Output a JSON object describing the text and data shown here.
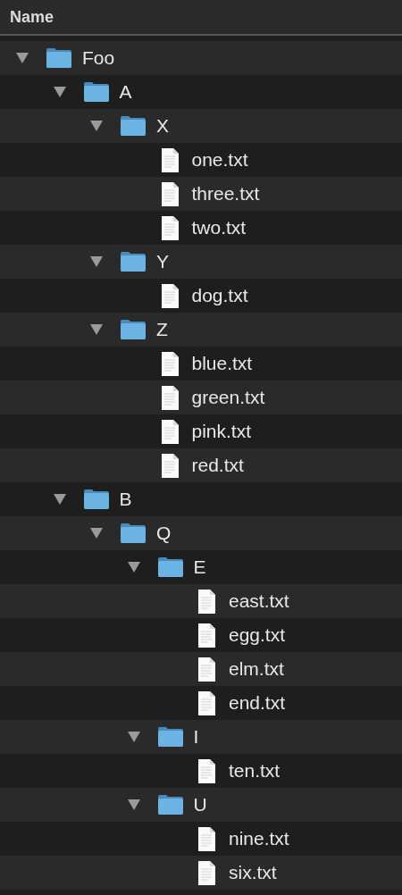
{
  "header": {
    "column_1": "Name"
  },
  "tree": [
    {
      "name": "Foo",
      "kind": "folder",
      "expanded": true,
      "children": [
        {
          "name": "A",
          "kind": "folder",
          "expanded": true,
          "children": [
            {
              "name": "X",
              "kind": "folder",
              "expanded": true,
              "children": [
                {
                  "name": "one.txt",
                  "kind": "file"
                },
                {
                  "name": "three.txt",
                  "kind": "file"
                },
                {
                  "name": "two.txt",
                  "kind": "file"
                }
              ]
            },
            {
              "name": "Y",
              "kind": "folder",
              "expanded": true,
              "children": [
                {
                  "name": "dog.txt",
                  "kind": "file"
                }
              ]
            },
            {
              "name": "Z",
              "kind": "folder",
              "expanded": true,
              "children": [
                {
                  "name": "blue.txt",
                  "kind": "file"
                },
                {
                  "name": "green.txt",
                  "kind": "file"
                },
                {
                  "name": "pink.txt",
                  "kind": "file"
                },
                {
                  "name": "red.txt",
                  "kind": "file"
                }
              ]
            }
          ]
        },
        {
          "name": "B",
          "kind": "folder",
          "expanded": true,
          "children": [
            {
              "name": "Q",
              "kind": "folder",
              "expanded": true,
              "children": [
                {
                  "name": "E",
                  "kind": "folder",
                  "expanded": true,
                  "children": [
                    {
                      "name": "east.txt",
                      "kind": "file"
                    },
                    {
                      "name": "egg.txt",
                      "kind": "file"
                    },
                    {
                      "name": "elm.txt",
                      "kind": "file"
                    },
                    {
                      "name": "end.txt",
                      "kind": "file"
                    }
                  ]
                },
                {
                  "name": "I",
                  "kind": "folder",
                  "expanded": true,
                  "children": [
                    {
                      "name": "ten.txt",
                      "kind": "file"
                    }
                  ]
                },
                {
                  "name": "U",
                  "kind": "folder",
                  "expanded": true,
                  "children": [
                    {
                      "name": "nine.txt",
                      "kind": "file"
                    },
                    {
                      "name": "six.txt",
                      "kind": "file"
                    }
                  ]
                }
              ]
            }
          ]
        }
      ]
    }
  ]
}
